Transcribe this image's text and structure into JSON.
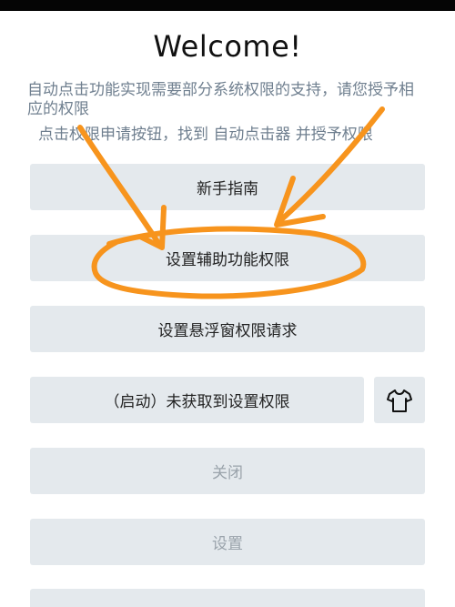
{
  "header": {
    "title": "Welcome!",
    "description": "自动点击功能实现需要部分系统权限的支持，请您授予相应的权限",
    "instruction": "点击权限申请按钮，找到 自动点击器 并授予权限"
  },
  "buttons": {
    "guide": "新手指南",
    "accessibility": "设置辅助功能权限",
    "overlay": "设置悬浮窗权限请求",
    "start": "（启动）未获取到设置权限",
    "close": "关闭",
    "settings": "设置",
    "skin_icon": "shirt-icon"
  },
  "annotation": {
    "color": "#f7941d"
  }
}
